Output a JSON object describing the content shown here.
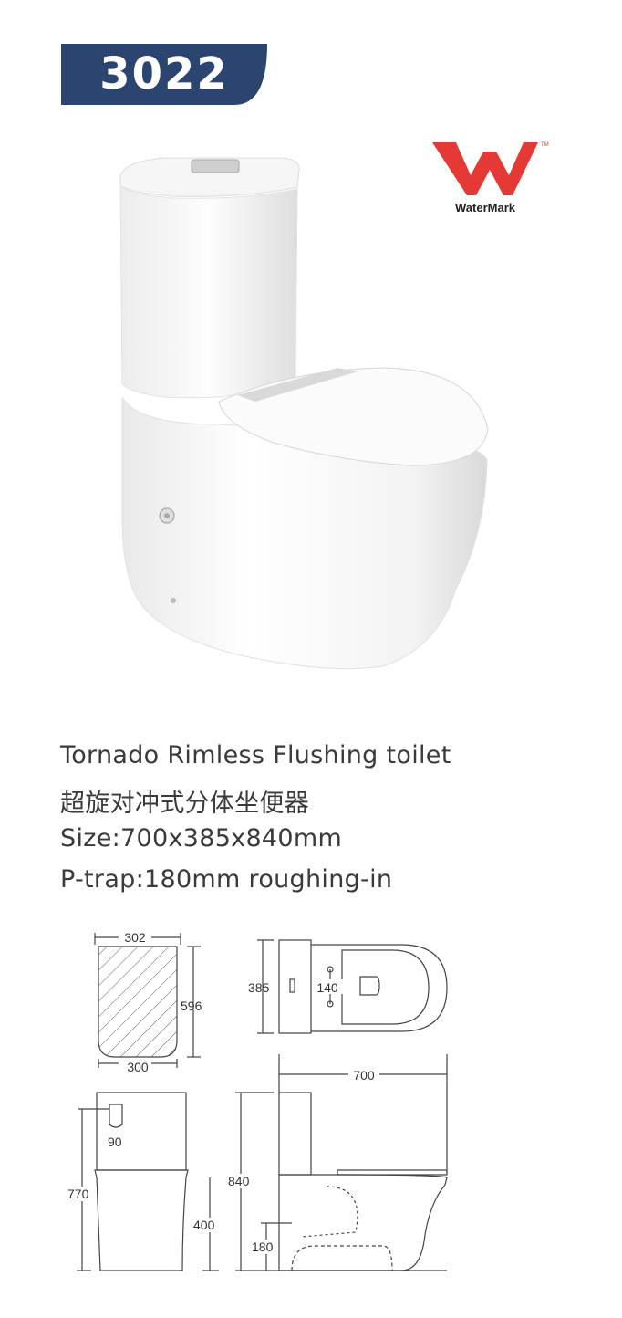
{
  "model": {
    "number": "3022",
    "tab_color": "#2b4570"
  },
  "certification": {
    "logo_text": "WaterMark",
    "logo_color": "#e53935",
    "icon": "watermark-logo-icon"
  },
  "product": {
    "name_en": "Tornado Rimless Flushing toilet",
    "name_cn": "超旋对冲式分体坐便器",
    "size": "Size:700x385x840mm",
    "trap": "P-trap:180mm roughing-in"
  },
  "dimensions": {
    "seat_top_width": "302",
    "seat_bottom_width": "300",
    "seat_length": "596",
    "top_view_width": "385",
    "outlet_spacing": "140",
    "overall_length": "700",
    "tank_offset": "90",
    "front_height": "770",
    "front_bowl_height": "400",
    "side_height": "840",
    "roughing_in": "180"
  }
}
